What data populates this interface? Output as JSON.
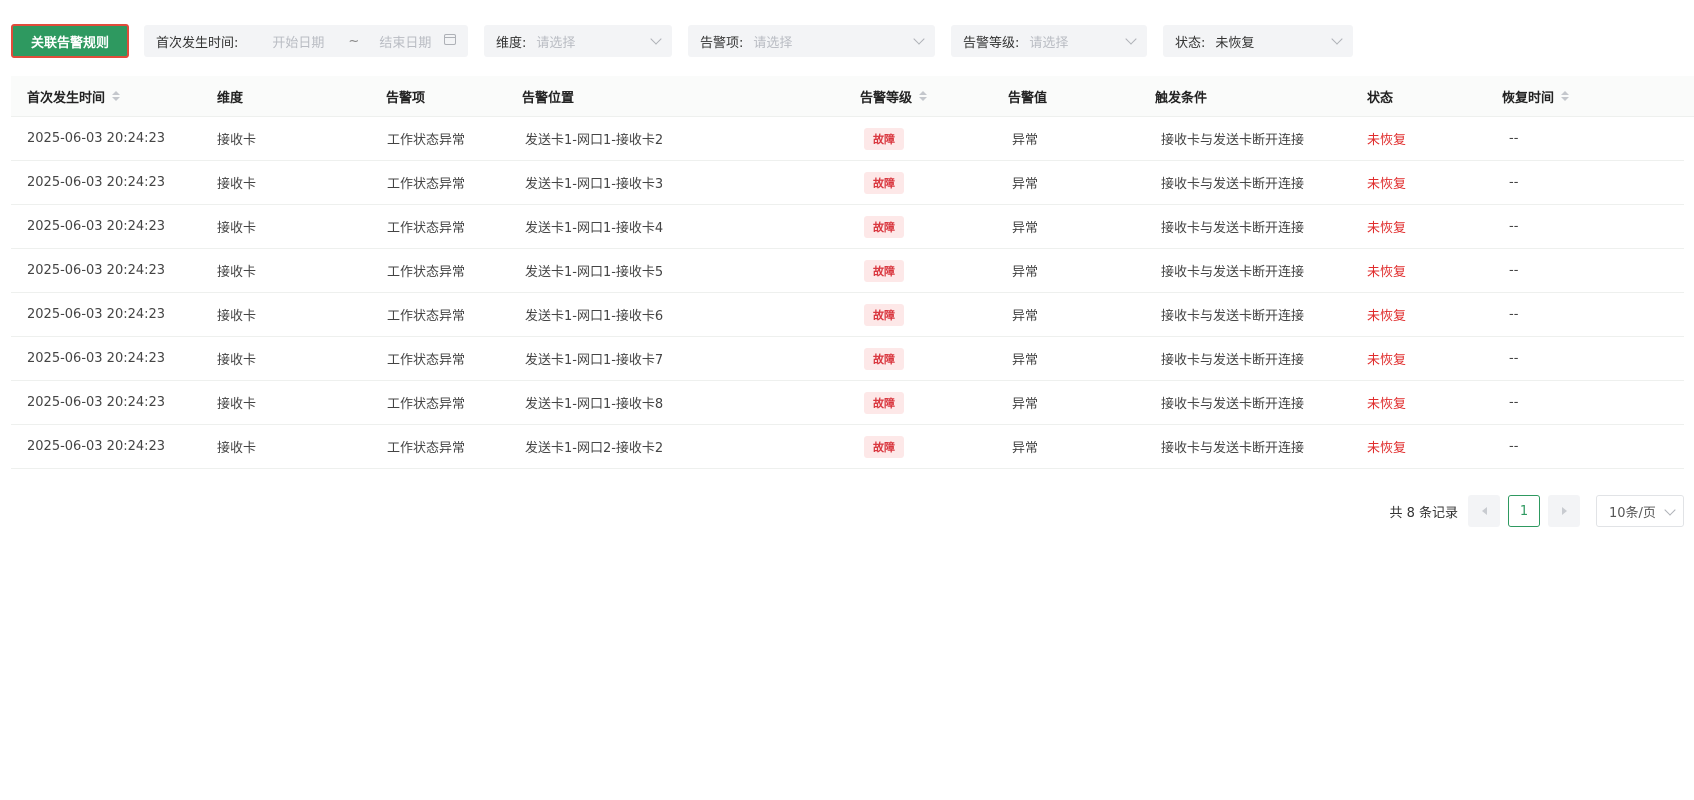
{
  "toolbar": {
    "primary_button": "关联告警规则",
    "filters": {
      "first_time": {
        "label": "首次发生时间:",
        "start_placeholder": "开始日期",
        "separator": "~",
        "end_placeholder": "结束日期"
      },
      "dimension": {
        "label": "维度:",
        "placeholder": "请选择"
      },
      "alarm_item": {
        "label": "告警项:",
        "placeholder": "请选择"
      },
      "alarm_level": {
        "label": "告警等级:",
        "placeholder": "请选择"
      },
      "status": {
        "label": "状态:",
        "value": "未恢复"
      }
    }
  },
  "table": {
    "columns": [
      "首次发生时间",
      "维度",
      "告警项",
      "告警位置",
      "告警等级",
      "告警值",
      "触发条件",
      "状态",
      "恢复时间"
    ],
    "rows": [
      {
        "time": "2025-06-03 20:24:23",
        "dimension": "接收卡",
        "item": "工作状态异常",
        "location": "发送卡1-网口1-接收卡2",
        "level": "故障",
        "value": "异常",
        "condition": "接收卡与发送卡断开连接",
        "status": "未恢复",
        "recover": "--"
      },
      {
        "time": "2025-06-03 20:24:23",
        "dimension": "接收卡",
        "item": "工作状态异常",
        "location": "发送卡1-网口1-接收卡3",
        "level": "故障",
        "value": "异常",
        "condition": "接收卡与发送卡断开连接",
        "status": "未恢复",
        "recover": "--"
      },
      {
        "time": "2025-06-03 20:24:23",
        "dimension": "接收卡",
        "item": "工作状态异常",
        "location": "发送卡1-网口1-接收卡4",
        "level": "故障",
        "value": "异常",
        "condition": "接收卡与发送卡断开连接",
        "status": "未恢复",
        "recover": "--"
      },
      {
        "time": "2025-06-03 20:24:23",
        "dimension": "接收卡",
        "item": "工作状态异常",
        "location": "发送卡1-网口1-接收卡5",
        "level": "故障",
        "value": "异常",
        "condition": "接收卡与发送卡断开连接",
        "status": "未恢复",
        "recover": "--"
      },
      {
        "time": "2025-06-03 20:24:23",
        "dimension": "接收卡",
        "item": "工作状态异常",
        "location": "发送卡1-网口1-接收卡6",
        "level": "故障",
        "value": "异常",
        "condition": "接收卡与发送卡断开连接",
        "status": "未恢复",
        "recover": "--"
      },
      {
        "time": "2025-06-03 20:24:23",
        "dimension": "接收卡",
        "item": "工作状态异常",
        "location": "发送卡1-网口1-接收卡7",
        "level": "故障",
        "value": "异常",
        "condition": "接收卡与发送卡断开连接",
        "status": "未恢复",
        "recover": "--"
      },
      {
        "time": "2025-06-03 20:24:23",
        "dimension": "接收卡",
        "item": "工作状态异常",
        "location": "发送卡1-网口1-接收卡8",
        "level": "故障",
        "value": "异常",
        "condition": "接收卡与发送卡断开连接",
        "status": "未恢复",
        "recover": "--"
      },
      {
        "time": "2025-06-03 20:24:23",
        "dimension": "接收卡",
        "item": "工作状态异常",
        "location": "发送卡1-网口2-接收卡2",
        "level": "故障",
        "value": "异常",
        "condition": "接收卡与发送卡断开连接",
        "status": "未恢复",
        "recover": "--"
      }
    ]
  },
  "pagination": {
    "total_text": "共 8 条记录",
    "current_page": "1",
    "page_size": "10条/页"
  },
  "colors": {
    "primary": "#2e9960",
    "danger": "#e02d2d",
    "tag_bg": "#fde8e8"
  }
}
